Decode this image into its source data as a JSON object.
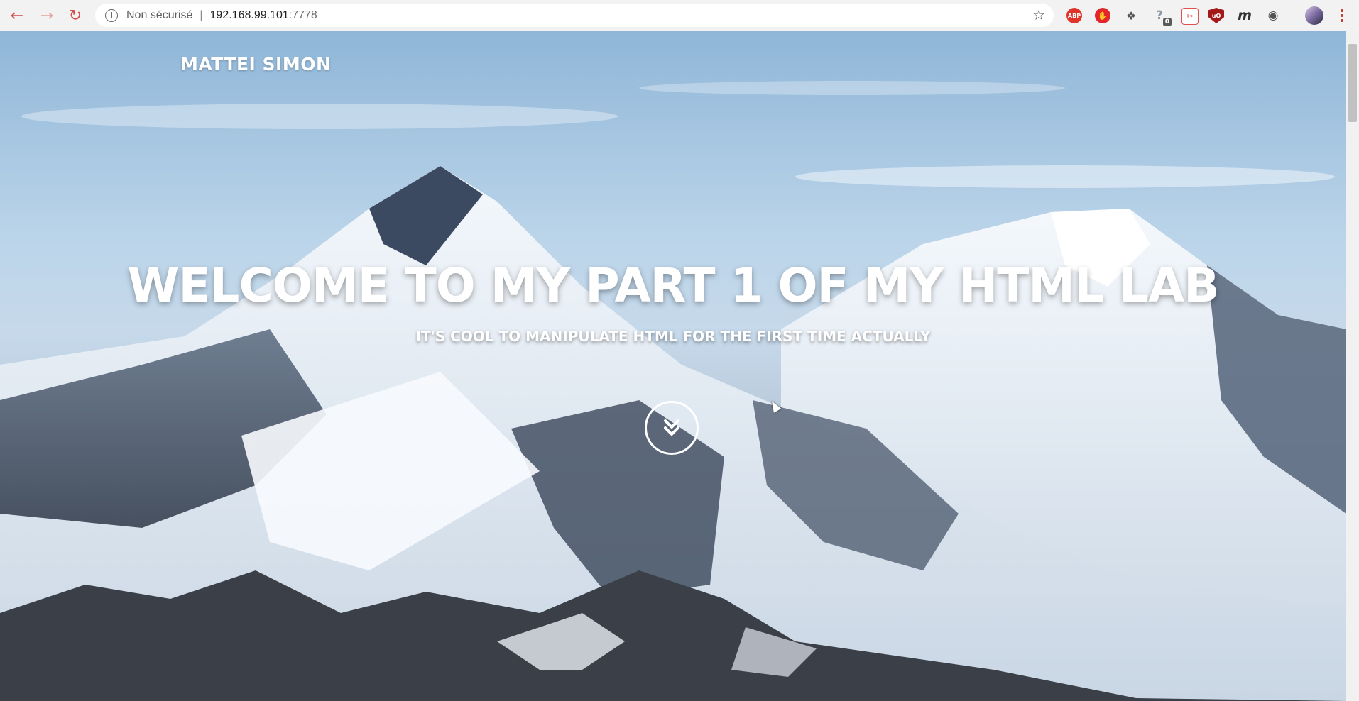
{
  "browser": {
    "omnibox": {
      "security_label": "Non sécurisé",
      "separator": "|",
      "host": "192.168.99.101",
      "port": ":7778"
    },
    "extensions": [
      {
        "name": "adblock-plus-icon",
        "text": "ABP"
      },
      {
        "name": "red-stop-extension-icon",
        "text": ""
      },
      {
        "name": "puzzle-extension-icon",
        "text": ""
      },
      {
        "name": "help-extension-icon",
        "text": "?",
        "badge": "0"
      },
      {
        "name": "clipper-extension-icon",
        "text": ""
      },
      {
        "name": "ublock-origin-icon",
        "text": "uO"
      },
      {
        "name": "m-extension-icon",
        "text": "m"
      },
      {
        "name": "incognito-extension-icon",
        "text": ""
      }
    ],
    "colors": {
      "accent": "#d34b4b",
      "chrome_bg": "#f2f2f2"
    }
  },
  "page": {
    "brand": "MATTEI SIMON",
    "hero": {
      "title": "WELCOME TO MY PART 1 OF MY HTML LAB",
      "subtitle": "IT'S COOL TO MANIPULATE HTML FOR THE FIRST TIME ACTUALLY"
    },
    "scroll_down_icon": "double-chevron-down-icon"
  }
}
